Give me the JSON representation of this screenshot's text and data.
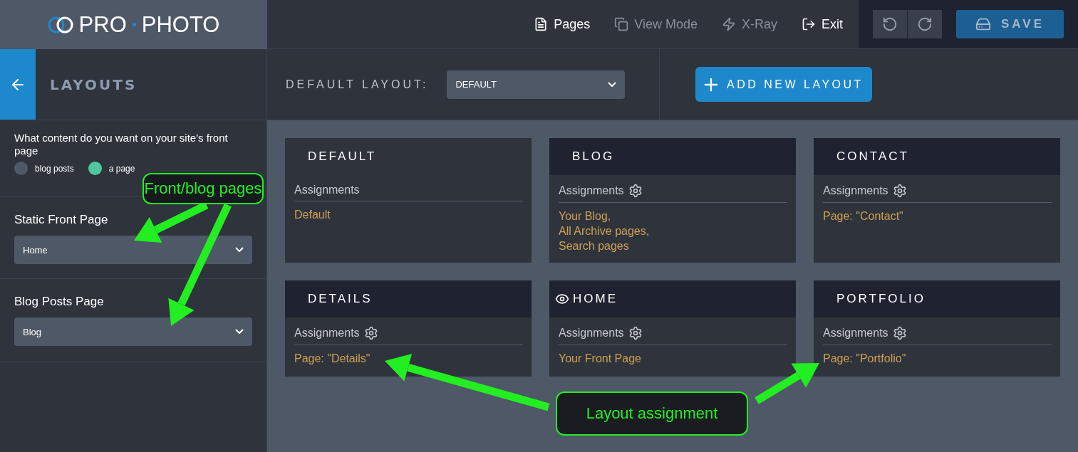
{
  "topbar": {
    "logo": [
      "PRO",
      "PHOTO"
    ],
    "nav": [
      {
        "label": "Pages",
        "kind": "page",
        "disabled": false
      },
      {
        "label": "View Mode",
        "kind": "windows",
        "disabled": true
      },
      {
        "label": "X-Ray",
        "kind": "bolt",
        "disabled": true
      },
      {
        "label": "Exit",
        "kind": "exit",
        "disabled": false
      }
    ],
    "save": "SAVE"
  },
  "sidebar": {
    "title": "LAYOUTS",
    "question": "What content do you want on your site's front page",
    "options": [
      {
        "label": "blog posts",
        "selected": false
      },
      {
        "label": "a page",
        "selected": true
      }
    ],
    "fields": [
      {
        "label": "Static Front Page",
        "value": "Home"
      },
      {
        "label": "Blog Posts Page",
        "value": "Blog"
      }
    ]
  },
  "main": {
    "default_layout": {
      "label": "DEFAULT LAYOUT:",
      "value": "DEFAULT"
    },
    "add_button": "ADD NEW LAYOUT",
    "layouts": [
      {
        "name": "DEFAULT",
        "active": false,
        "gear": false,
        "assignments_label": "Assignments",
        "assignments": [
          "Default"
        ]
      },
      {
        "name": "BLOG",
        "active": false,
        "gear": true,
        "assignments_label": "Assignments",
        "assignments": [
          "Your Blog,",
          "All Archive pages,",
          "Search pages"
        ]
      },
      {
        "name": "CONTACT",
        "active": false,
        "gear": true,
        "assignments_label": "Assignments",
        "assignments": [
          "Page: \"Contact\""
        ]
      },
      {
        "name": "DETAILS",
        "active": false,
        "gear": true,
        "assignments_label": "Assignments",
        "assignments": [
          "Page: \"Details\""
        ]
      },
      {
        "name": "HOME",
        "active": true,
        "gear": true,
        "assignments_label": "Assignments",
        "assignments": [
          "Your Front Page"
        ]
      },
      {
        "name": "PORTFOLIO",
        "active": false,
        "gear": true,
        "assignments_label": "Assignments",
        "assignments": [
          "Page: \"Portfolio\""
        ]
      }
    ]
  },
  "annotations": [
    {
      "text": "Front/blog pages"
    },
    {
      "text": "Layout assignment"
    }
  ]
}
